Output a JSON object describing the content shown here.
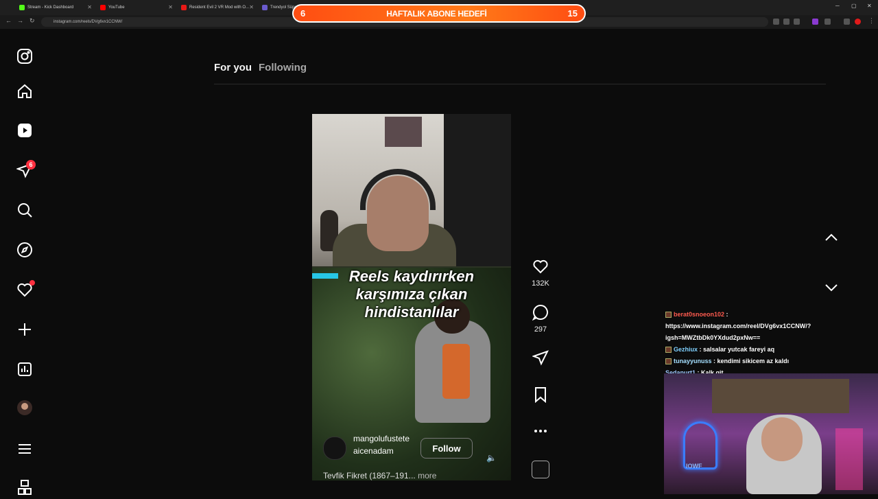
{
  "browser": {
    "tabs": [
      {
        "title": "Stream - Kick Dashboard",
        "color": "#53fc18"
      },
      {
        "title": "YouTube",
        "color": "#ff0000"
      },
      {
        "title": "Resident Evil 2 VR Mod with O...",
        "color": "#e91916"
      },
      {
        "title": "Trendyol Süpe...",
        "color": "#6a5acd"
      }
    ],
    "url": "instagram.com/reels/DVg6vx1CCNW/"
  },
  "goal_overlay": {
    "left_num": "6",
    "title": "HAFTALIK ABONE HEDEFİ",
    "right_num": "15"
  },
  "sidebar": {
    "notifications_badge": "6"
  },
  "feed": {
    "tab_for_you": "For you",
    "tab_following": "Following"
  },
  "reel": {
    "caption_line1": "Reels kaydırırken",
    "caption_line2": "karşımıza çıkan",
    "caption_line3": "hindistanlılar",
    "owner": "mangolufusteteaicenadam",
    "follow_label": "Follow",
    "description": "Tevfik Fikret (1867–191...",
    "more_label": "more"
  },
  "actions": {
    "likes": "132K",
    "comments": "297"
  },
  "chat": [
    {
      "user": "berat0snoeon102",
      "text": "https://www.instagram.com/reel/DVg6vx1CCNW/?igsh=MWZtbDk0YXdud2pxNw=="
    },
    {
      "user": "Gezhiux",
      "text": "salsalar yutcak fareyi aq"
    },
    {
      "user": "tunayyunuss",
      "text": "kendimi sikicem az kaldı"
    },
    {
      "user": "Sedanurt1",
      "text": "Kalk git"
    }
  ],
  "webcam": {
    "sign_text": "IOWF"
  }
}
